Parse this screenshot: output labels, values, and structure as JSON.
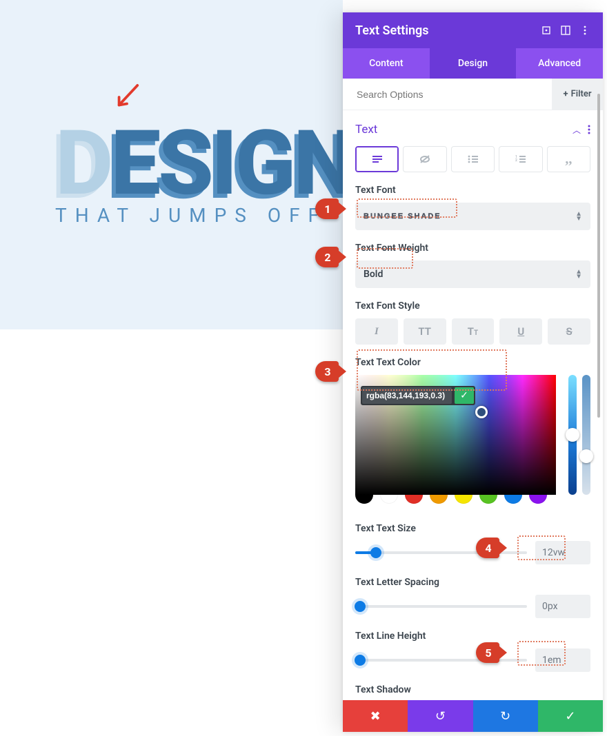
{
  "preview": {
    "headline": "DESIGN",
    "subline": "THAT JUMPS OFF T"
  },
  "panel": {
    "title": "Text Settings",
    "tabs": {
      "content": "Content",
      "design": "Design",
      "advanced": "Advanced",
      "active": "Design"
    },
    "search_placeholder": "Search Options",
    "filter_label": "Filter",
    "section_title": "Text",
    "text_type_tabs": [
      "paragraph",
      "link",
      "ul",
      "ol",
      "quote"
    ],
    "fields": {
      "font": {
        "label": "Text Font",
        "value": "BUNGEE SHADE"
      },
      "font_weight": {
        "label": "Text Font Weight",
        "value": "Bold"
      },
      "font_style": {
        "label": "Text Font Style"
      },
      "text_color": {
        "label": "Text Text Color",
        "value": "rgba(83,144,193,0.3)"
      },
      "text_size": {
        "label": "Text Text Size",
        "value": "12vw",
        "percent": 12
      },
      "letter_spacing": {
        "label": "Text Letter Spacing",
        "value": "0px",
        "percent": 0
      },
      "line_height": {
        "label": "Text Line Height",
        "value": "1em",
        "percent": 0
      },
      "shadow": {
        "label": "Text Shadow"
      }
    },
    "swatches": [
      "#000000",
      "#ffffff",
      "#e12f26",
      "#f09a00",
      "#f6e500",
      "#58c322",
      "#0d7be5",
      "#8a12ef"
    ],
    "hue_knob_pct": 44,
    "alpha_knob_pct": 62
  },
  "callouts": {
    "1": 1,
    "2": 2,
    "3": 3,
    "4": 4,
    "5": 5
  }
}
